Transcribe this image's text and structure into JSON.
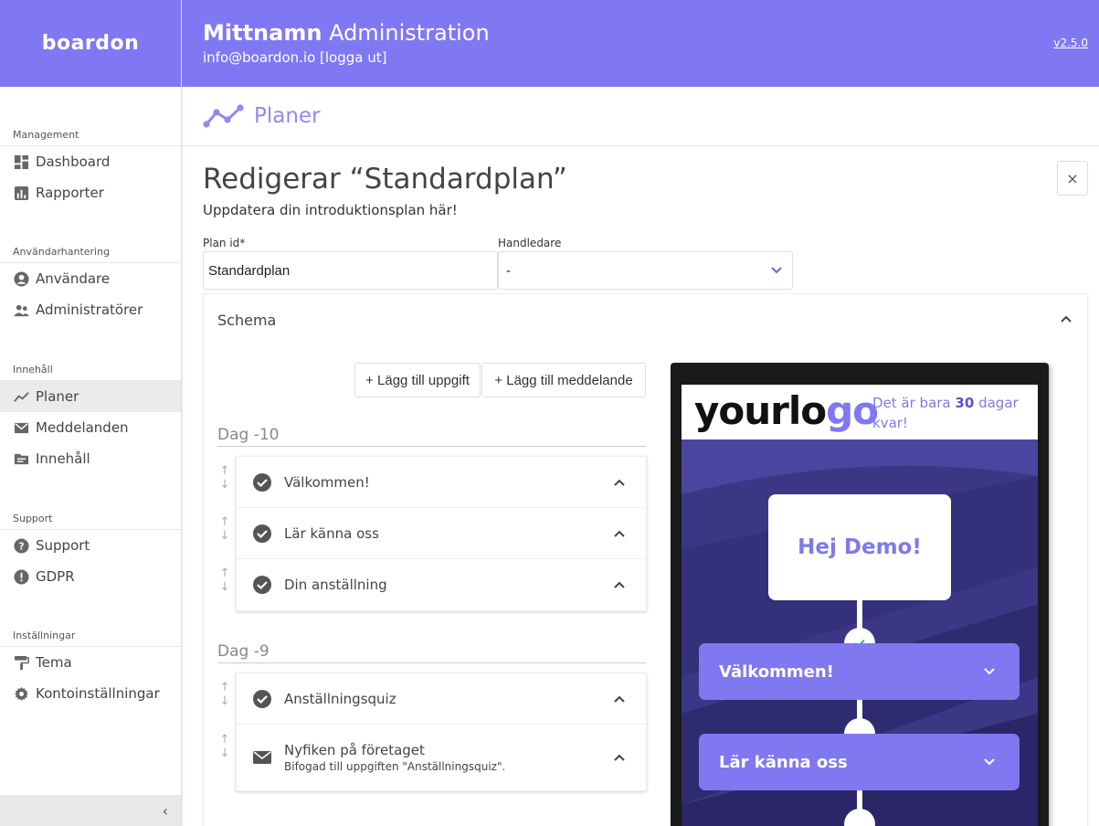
{
  "brand": {
    "logo_text": "boardon",
    "accent": "#8078f2"
  },
  "header": {
    "title_bold": "Mittnamn",
    "title_rest": "Administration",
    "user": "info@boardon.io [logga ut]",
    "version": "v2.5.0"
  },
  "sidebar": {
    "sections": [
      {
        "title": "Management",
        "items": [
          {
            "label": "Dashboard",
            "icon": "dashboard-icon"
          },
          {
            "label": "Rapporter",
            "icon": "bar-chart-icon"
          }
        ]
      },
      {
        "title": "Användarhantering",
        "items": [
          {
            "label": "Användare",
            "icon": "user-circle-icon"
          },
          {
            "label": "Administratörer",
            "icon": "users-icon"
          }
        ]
      },
      {
        "title": "Innehåll",
        "items": [
          {
            "label": "Planer",
            "icon": "trend-line-icon"
          },
          {
            "label": "Meddelanden",
            "icon": "envelope-icon"
          },
          {
            "label": "Innehåll",
            "icon": "folder-icon"
          }
        ]
      },
      {
        "title": "Support",
        "items": [
          {
            "label": "Support",
            "icon": "help-icon"
          },
          {
            "label": "GDPR",
            "icon": "alert-icon"
          }
        ]
      },
      {
        "title": "Inställningar",
        "items": [
          {
            "label": "Tema",
            "icon": "paint-roller-icon"
          },
          {
            "label": "Kontoinställningar",
            "icon": "gear-icon"
          }
        ]
      }
    ],
    "active": "Planer",
    "collapse_glyph": "‹"
  },
  "page": {
    "section_title": "Planer",
    "edit_title": "Redigerar “Standardplan”",
    "edit_subtitle": "Uppdatera din introduktionsplan här!",
    "close_glyph": "×",
    "plan_id_label": "Plan id*",
    "plan_id_value": "Standardplan",
    "handledare_label": "Handledare",
    "handledare_value": "-"
  },
  "schema": {
    "title": "Schema",
    "add_task": "+ Lägg till uppgift",
    "add_message": "+ Lägg till meddelande",
    "days": [
      {
        "label": "Dag -10",
        "tasks": [
          {
            "label": "Välkommen!",
            "type": "task"
          },
          {
            "label": "Lär känna oss",
            "type": "task"
          },
          {
            "label": "Din anställning",
            "type": "task"
          }
        ]
      },
      {
        "label": "Dag -9",
        "tasks": [
          {
            "label": "Anställningsquiz",
            "type": "task"
          },
          {
            "label": "Nyfiken på företaget",
            "sub": "Bifogad till uppgiften \"Anställningsquiz\".",
            "type": "message"
          }
        ]
      }
    ]
  },
  "preview": {
    "logo_a": "yourlo",
    "logo_b": "go",
    "days_pre": "Det är bara",
    "days_num": "30",
    "days_post": "dagar kvar!",
    "greeting": "Hej Demo!",
    "steps": [
      "Välkommen!",
      "Lär känna oss"
    ]
  }
}
